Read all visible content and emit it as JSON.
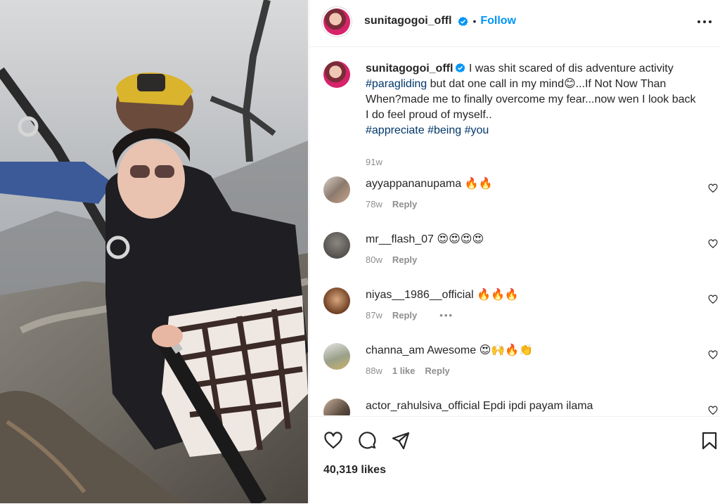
{
  "post": {
    "username": "sunitagogoi_offl",
    "follow_label": "Follow",
    "dot": "•",
    "caption_text_1": "I was shit scared of dis adventure activity",
    "caption_hashtag_1": "#paragliding",
    "caption_text_2": "but dat one call in my mind😊...If Not Now Than When?made me to finally overcome my fear...now wen I look back I do feel proud of myself..",
    "caption_hashtags": [
      "#appreciate",
      "#being",
      "#you"
    ],
    "caption_time": "91w",
    "likes": "40,319 likes"
  },
  "comments": [
    {
      "user": "ayyappananupama",
      "text": "🔥🔥",
      "time": "78w",
      "likes": "",
      "reply": "Reply",
      "more": ""
    },
    {
      "user": "mr__flash_07",
      "text": "😍😍😍😍",
      "time": "80w",
      "likes": "",
      "reply": "Reply",
      "more": ""
    },
    {
      "user": "niyas__1986__official",
      "text": "🔥🔥🔥",
      "time": "87w",
      "likes": "",
      "reply": "Reply",
      "more": "•••"
    },
    {
      "user": "channa_am",
      "text": "Awesome 😍🙌🔥👏",
      "time": "88w",
      "likes": "1 like",
      "reply": "Reply",
      "more": ""
    },
    {
      "user": "actor_rahulsiva_official",
      "text": "Epdi ipdi payam ilama",
      "time": "",
      "likes": "",
      "reply": "",
      "more": ""
    }
  ],
  "icons": {
    "verified": "verified-badge-icon",
    "more": "more-options-icon",
    "like": "heart-icon",
    "comment": "comment-icon",
    "share": "share-icon",
    "save": "bookmark-icon"
  },
  "colors": {
    "accent": "#0095f6",
    "hashtag": "#00376b",
    "verified": "#0095f6",
    "muted": "#8e8e8e"
  }
}
